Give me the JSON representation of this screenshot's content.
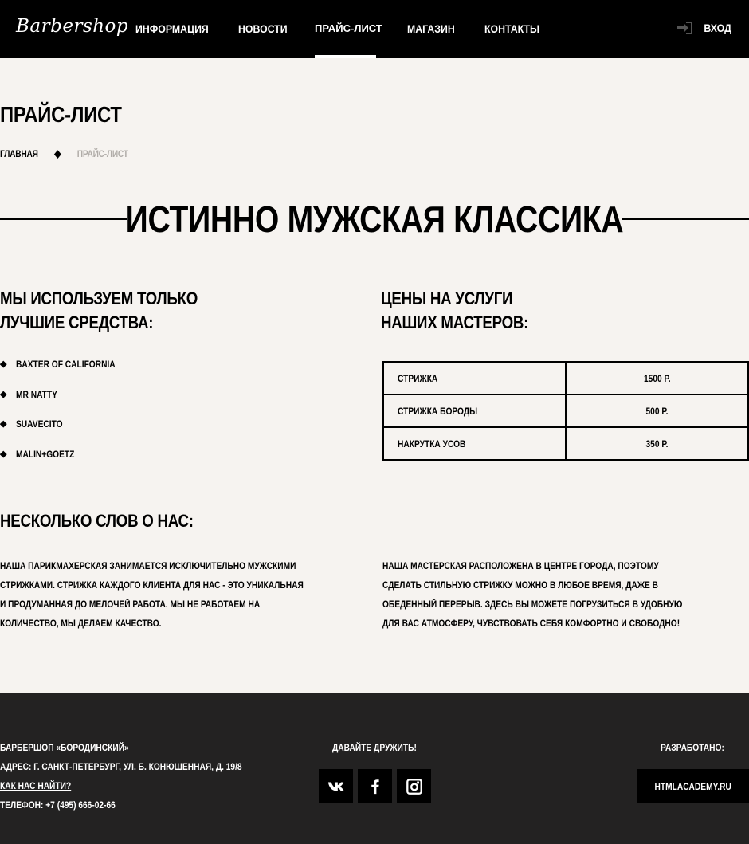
{
  "header": {
    "logo": "Barbershop",
    "nav": [
      "ИНФОРМАЦИЯ",
      "НОВОСТИ",
      "ПРАЙС-ЛИСТ",
      "МАГАЗИН",
      "КОНТАКТЫ"
    ],
    "active_nav": "ПРАЙС-ЛИСТ",
    "login_label": "ВХОД"
  },
  "page": {
    "title": "ПРАЙС-ЛИСТ",
    "breadcrumb_home": "ГЛАВНАЯ",
    "breadcrumb_sep": "◆",
    "breadcrumb_current": "ПРАЙС-ЛИСТ",
    "section_title": "ИСТИННО МУЖСКАЯ КЛАССИКА"
  },
  "brands": {
    "title_line1": "МЫ ИСПОЛЬЗУЕМ ТОЛЬКО",
    "title_line2": "ЛУЧШИЕ СРЕДСТВА:",
    "items": [
      "BAXTER OF CALIFORNIA",
      "MR NATTY",
      "SUAVECITO",
      "MALIN+GOETZ"
    ]
  },
  "prices": {
    "title_line1": "ЦЕНЫ НА УСЛУГИ",
    "title_line2": "НАШИХ МАСТЕРОВ:",
    "rows": [
      {
        "service": "СТРИЖКА",
        "price": "1500 Р."
      },
      {
        "service": "СТРИЖКА БОРОДЫ",
        "price": "500 Р."
      },
      {
        "service": "НАКРУТКА УСОВ",
        "price": "350 Р."
      }
    ]
  },
  "about": {
    "title": "НЕСКОЛЬКО СЛОВ О НАС:",
    "left_lines": [
      "НАША ПАРИКМАХЕРСКАЯ ЗАНИМАЕТСЯ ИСКЛЮЧИТЕЛЬНО МУЖСКИМИ",
      "СТРИЖКАМИ. СТРИЖКА КАЖДОГО КЛИЕНТА ДЛЯ НАС - ЭТО УНИКАЛЬНАЯ",
      "И ПРОДУМАННАЯ ДО МЕЛОЧЕЙ РАБОТА. МЫ НЕ РАБОТАЕМ НА",
      "КОЛИЧЕСТВО, МЫ ДЕЛАЕМ КАЧЕСТВО."
    ],
    "right_lines": [
      "НАША МАСТЕРСКАЯ РАСПОЛОЖЕНА В ЦЕНТРЕ ГОРОДА, ПОЭТОМУ",
      "СДЕЛАТЬ СТИЛЬНУЮ СТРИЖКУ МОЖНО В ЛЮБОЕ ВРЕМЯ, ДАЖЕ В",
      "ОБЕДЕННЫЙ ПЕРЕРЫВ. ЗДЕСЬ ВЫ МОЖЕТЕ ПОГРУЗИТЬСЯ В УДОБНУЮ",
      "ДЛЯ ВАС АТМОСФЕРУ, ЧУВСТВОВАТЬ СЕБЯ КОМФОРТНО И СВОБОДНО!"
    ]
  },
  "footer": {
    "name": "БАРБЕРШОП «БОРОДИНСКИЙ»",
    "address": "АДРЕС: Г. САНКТ-ПЕТЕРБУРГ, УЛ. Б. КОНЮШЕННАЯ, Д. 19/8",
    "find_link": "КАК НАС НАЙТИ?",
    "phone": "ТЕЛЕФОН: +7 (495) 666-02-66",
    "social_title": "ДАВАЙТЕ ДРУЖИТЬ!",
    "social_icons": [
      "vk-icon",
      "facebook-icon",
      "instagram-icon"
    ],
    "dev_title": "РАЗРАБОТАНО:",
    "dev_link": "HTMLACADEMY.RU"
  },
  "colors": {
    "background": "#f6f3f0",
    "header": "#000000",
    "footer": "#232222",
    "muted": "#b0aca8"
  }
}
